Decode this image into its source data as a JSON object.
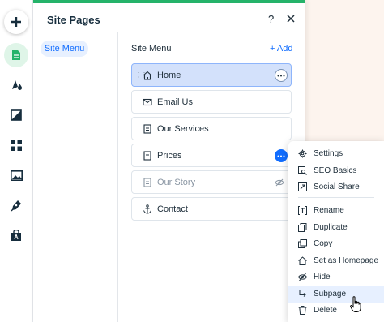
{
  "panel": {
    "title": "Site Pages",
    "help_label": "?",
    "side_tab": "Site Menu",
    "list_title": "Site Menu",
    "add_label": "+ Add"
  },
  "pages": [
    {
      "label": "Home",
      "icon": "home-icon",
      "state": "selected"
    },
    {
      "label": "Email Us",
      "icon": "envelope-icon",
      "state": "normal"
    },
    {
      "label": "Our Services",
      "icon": "page-icon",
      "state": "normal"
    },
    {
      "label": "Prices",
      "icon": "page-icon",
      "state": "menu-open"
    },
    {
      "label": "Our Story",
      "icon": "page-icon",
      "state": "hidden"
    },
    {
      "label": "Contact",
      "icon": "anchor-icon",
      "state": "normal"
    }
  ],
  "menu": {
    "items": [
      {
        "label": "Settings",
        "icon": "gear-icon"
      },
      {
        "label": "SEO Basics",
        "icon": "seo-icon"
      },
      {
        "label": "Social Share",
        "icon": "share-icon"
      },
      {
        "label": "Rename",
        "icon": "text-icon"
      },
      {
        "label": "Duplicate",
        "icon": "duplicate-icon"
      },
      {
        "label": "Copy",
        "icon": "copy-icon"
      },
      {
        "label": "Set as Homepage",
        "icon": "home-icon"
      },
      {
        "label": "Hide",
        "icon": "eye-hidden-icon"
      },
      {
        "label": "Subpage",
        "icon": "subpage-icon"
      },
      {
        "label": "Delete",
        "icon": "trash-icon"
      }
    ]
  },
  "colors": {
    "accent": "#116dff",
    "brand_green": "#25b36a",
    "selected_bg": "#d3e1fb"
  }
}
